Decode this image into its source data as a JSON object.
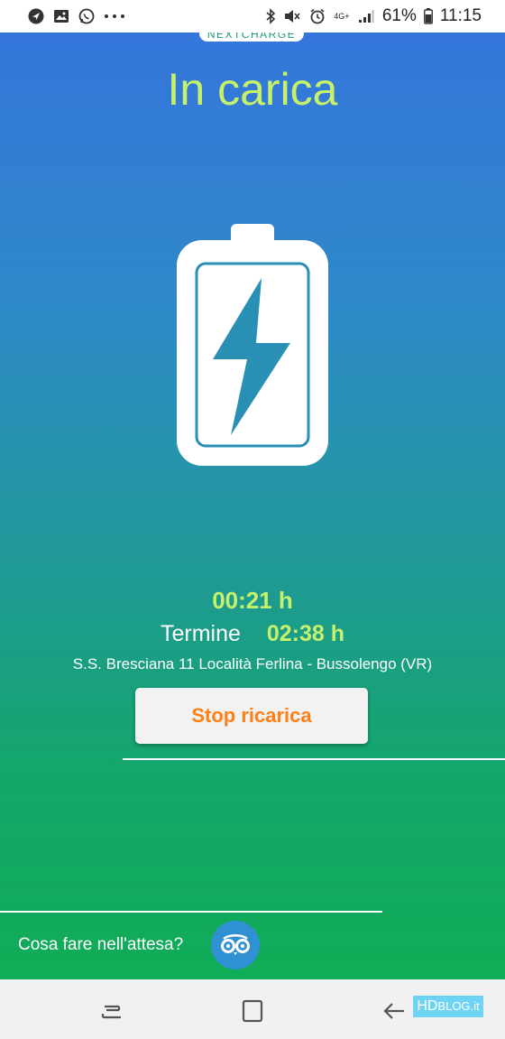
{
  "status_bar": {
    "battery_percent": "61%",
    "time": "11:15",
    "network": "4G+",
    "left_icons": [
      "navigation-icon",
      "gallery-icon",
      "whatsapp-icon",
      "more-icon"
    ],
    "right_icons": [
      "bluetooth-icon",
      "mute-icon",
      "alarm-icon",
      "signal-icon",
      "battery-icon"
    ]
  },
  "app": {
    "brand": "NEXTCHARGE",
    "title": "In carica",
    "elapsed": "00:21 h",
    "end_label": "Termine",
    "end_value": "02:38 h",
    "address": "S.S. Bresciana 11 Località Ferlina - Bussolengo (VR)",
    "stop_button": "Stop ricarica",
    "footer_label": "Cosa fare nell'attesa?"
  },
  "watermark": {
    "hd": "HD",
    "blog": "BLOG.it"
  },
  "colors": {
    "accent_green": "#c5f16b",
    "stop_orange": "#ff7f15",
    "gradient_top": "#3576dc",
    "gradient_bottom": "#10ac56",
    "owl_blue": "#2f90d2"
  }
}
